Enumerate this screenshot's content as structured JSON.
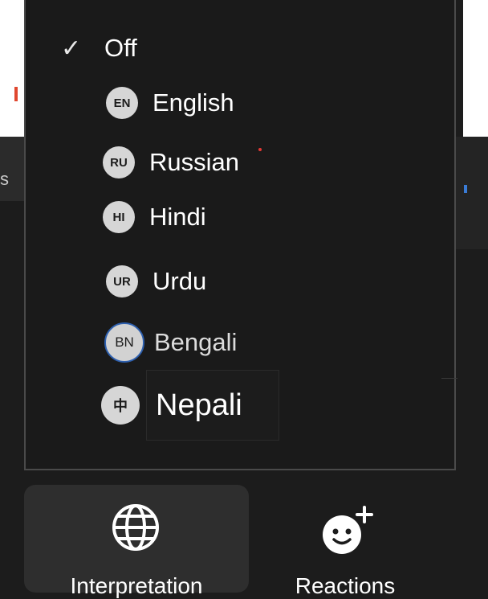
{
  "menu": {
    "items": [
      {
        "label": "Off",
        "checked": true
      },
      {
        "badge": "EN",
        "label": "English"
      },
      {
        "badge": "RU",
        "label": "Russian"
      },
      {
        "badge": "HI",
        "label": "Hindi"
      },
      {
        "badge": "UR",
        "label": "Urdu"
      },
      {
        "badge": "BN",
        "label": "Bengali"
      },
      {
        "badge": "中",
        "label": "Nepali"
      }
    ],
    "check_icon": "✓"
  },
  "background": {
    "partial_letter": "s"
  },
  "toolbar": {
    "interpretation_label": "Interpretation",
    "reactions_label": "Reactions"
  },
  "colors": {
    "menu_bg": "#1a1a1a",
    "menu_border": "#4a4a4a",
    "badge_bg": "#d6d6d6",
    "bengali_outline": "#2d5fae",
    "red_dot": "#e53935"
  }
}
